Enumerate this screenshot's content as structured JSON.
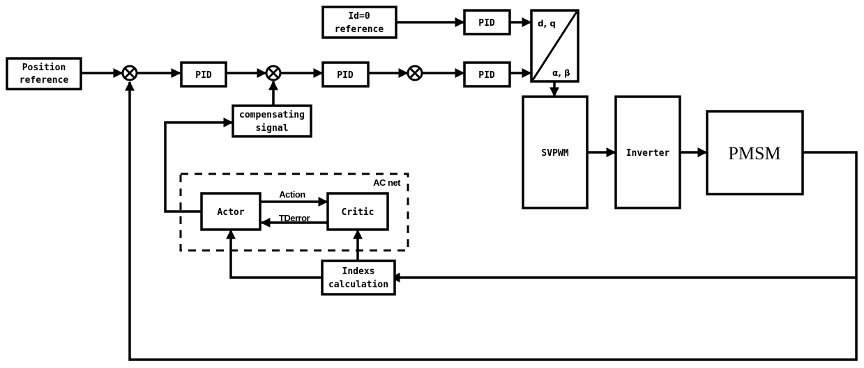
{
  "diagram": {
    "blocks": {
      "position_reference": {
        "line1": "Position",
        "line2": "reference"
      },
      "id_reference": {
        "line1": "Id=0",
        "line2": "reference"
      },
      "pid_position": {
        "label": "PID"
      },
      "pid_speed": {
        "label": "PID"
      },
      "pid_iq": {
        "label": "PID"
      },
      "pid_id": {
        "label": "PID"
      },
      "compensating_signal": {
        "line1": "compensating",
        "line2": "signal"
      },
      "transform": {
        "top_label": "d, q",
        "bottom_label": "α, β"
      },
      "svpwm": {
        "label": "SVPWM"
      },
      "inverter": {
        "label": "Inverter"
      },
      "pmsm": {
        "label": "PMSM"
      },
      "actor": {
        "label": "Actor"
      },
      "critic": {
        "label": "Critic"
      },
      "indexs_calculation": {
        "line1": "Indexs",
        "line2": "calculation"
      }
    },
    "group": {
      "label": "AC net"
    },
    "edge_labels": {
      "action": "Action",
      "tderror": "TDerror"
    },
    "summing_junction_symbol": "⊗"
  }
}
